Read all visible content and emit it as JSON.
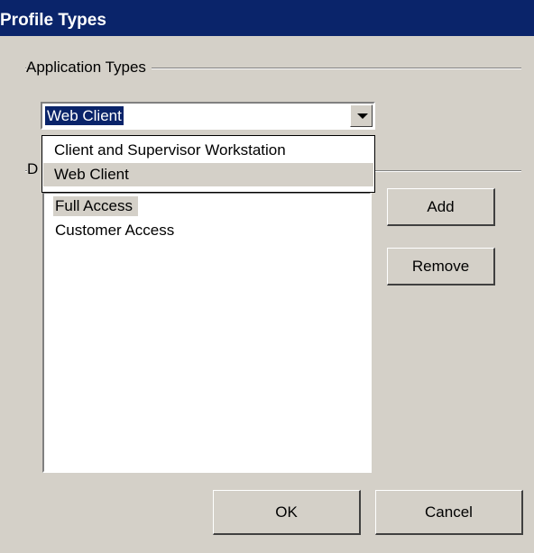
{
  "title": "Profile Types",
  "application_types": {
    "group_label": "Application Types",
    "selected_value": "Web Client",
    "options": [
      "Client and Supervisor Workstation",
      "Web Client"
    ]
  },
  "profiles": {
    "group_label_partial": "D",
    "items": [
      "Full Access",
      "Customer Access"
    ]
  },
  "buttons": {
    "add": "Add",
    "remove": "Remove",
    "ok": "OK",
    "cancel": "Cancel"
  }
}
